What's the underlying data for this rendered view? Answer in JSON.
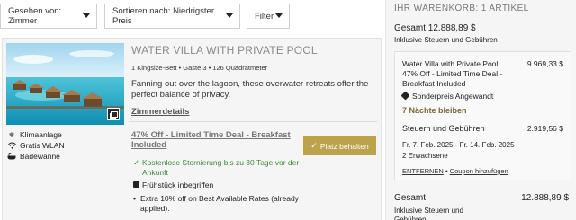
{
  "filters": {
    "view_by": "Gesehen von: Zimmer",
    "sort_by": "Sortieren nach: Niedrigster Preis",
    "filter": "Filter"
  },
  "room": {
    "title": "WATER VILLA WITH PRIVATE POOL",
    "meta": "1 Kingsize-Bett  •  Gäste 3  •  126 Quadratmeter",
    "description": "Fanning out over the lagoon, these overwater retreats offer the perfect balance of privacy.",
    "details_link": "Zimmerdetails",
    "amenities": [
      {
        "icon": "air-conditioning-icon",
        "label": "Klimaanlage"
      },
      {
        "icon": "wifi-icon",
        "label": "Gratis WLAN"
      },
      {
        "icon": "bathtub-icon",
        "label": "Badewanne"
      }
    ],
    "rate": {
      "title_line1": "47% Off - Limited Time Deal - Breakfast",
      "title_line2": "Included",
      "keep_button": "Platz behalten",
      "cancellation": "Kostenlose Stornierung bis zu 30 Tage vor der Ankunft",
      "breakfast": "Frühstück inbegriffen",
      "extra": "Extra 10% off on Best Available Rates (already applied)."
    }
  },
  "cart": {
    "heading": "IHR WARENKORB: 1 ARTIKEL",
    "total_top": "Gesamt 12.888,89 $",
    "tax_note_top": "Inklusive Steuern und Gebühren",
    "item": {
      "name": "Water Villa with Private Pool 47% Off - Limited Time Deal - Breakfast Included",
      "price": "9.969,33 $",
      "special": "Sonderpreis Angewandt",
      "nights": "7 Nächte bleiben",
      "taxes_label": "Steuern und Gebühren",
      "taxes_value": "2.919,56 $",
      "dates": "Fr. 7. Feb. 2025 - Fr. 14. Feb. 2025",
      "guests": "2 Erwachsene",
      "remove": "ENTFERNEN",
      "coupon": "Coupon hinzufügen"
    },
    "total_label": "Gesamt",
    "total_value": "12.888,89 $",
    "total_tax_note": "Inklusive Steuern und Gebühren"
  },
  "colors": {
    "accent": "#bca34b",
    "success": "#3a8a3a",
    "nights": "#7a6a30"
  }
}
